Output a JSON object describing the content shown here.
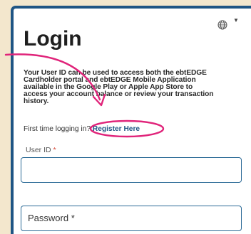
{
  "header": {
    "title": "Login",
    "language_icon": "globe-icon",
    "language_menu_icon": "caret-down-icon"
  },
  "intro": {
    "lines": [
      "Your User ID can be used to access both the ebtEDGE",
      "Cardholder portal and ebtEDGE Mobile Application",
      "available in the Google Play or Apple App Store to",
      "access your account balance or review your transaction",
      "history."
    ]
  },
  "first_time": {
    "prompt": "First time logging in?",
    "link": "Register Here"
  },
  "form": {
    "user_id": {
      "label": "User ID",
      "required_mark": "*",
      "value": ""
    },
    "password": {
      "label": "Password *",
      "value": ""
    }
  },
  "colors": {
    "accent": "#1f5584",
    "annotation": "#e0247a",
    "required": "#d64a3a",
    "background": "#f3e7cd"
  }
}
